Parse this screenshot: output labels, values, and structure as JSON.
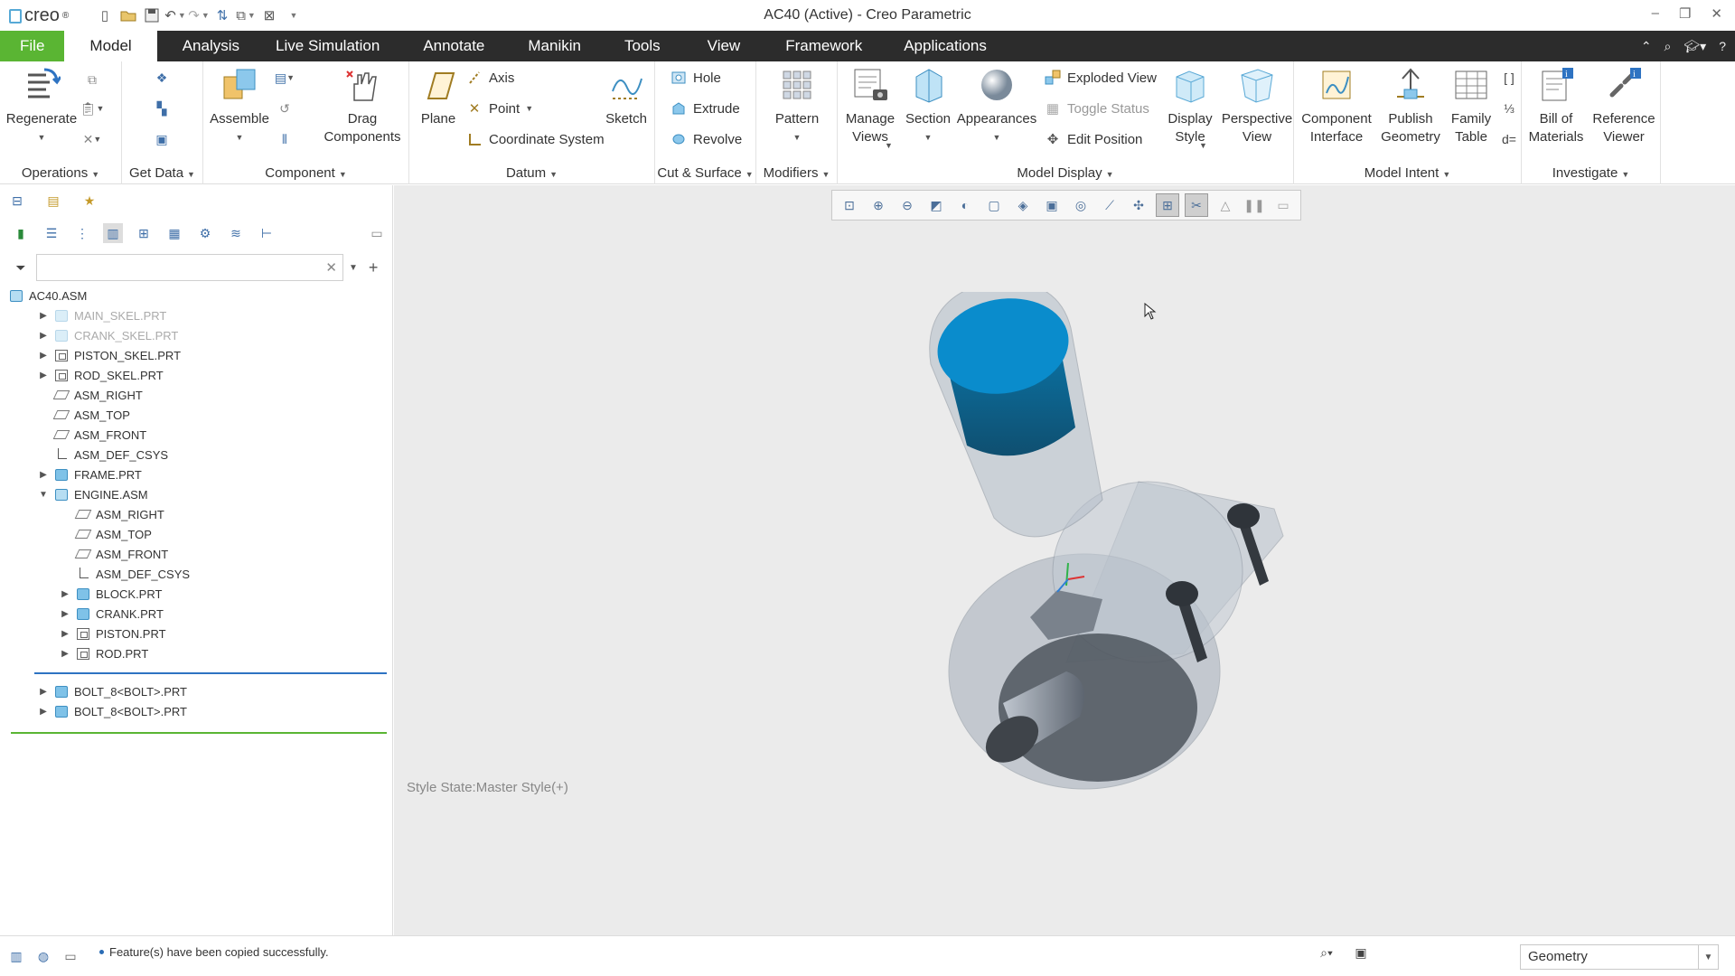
{
  "window": {
    "app_name": "creo",
    "title": "AC40 (Active) - Creo Parametric"
  },
  "menu_tabs": [
    "File",
    "Model",
    "Analysis",
    "Live Simulation",
    "Annotate",
    "Manikin",
    "Tools",
    "View",
    "Framework",
    "Applications"
  ],
  "ribbon": {
    "operations": {
      "label": "Operations",
      "regenerate": "Regenerate"
    },
    "get_data": {
      "label": "Get Data"
    },
    "component": {
      "label": "Component",
      "assemble": "Assemble",
      "drag": "Drag\nComponents"
    },
    "datum": {
      "label": "Datum",
      "plane": "Plane",
      "axis": "Axis",
      "point": "Point",
      "csys": "Coordinate System",
      "sketch": "Sketch"
    },
    "cut_surface": {
      "label": "Cut & Surface",
      "hole": "Hole",
      "extrude": "Extrude",
      "revolve": "Revolve"
    },
    "modifiers": {
      "label": "Modifiers",
      "pattern": "Pattern"
    },
    "model_display": {
      "label": "Model Display",
      "manage_views": "Manage\nViews",
      "section": "Section",
      "appearances": "Appearances",
      "exploded_view": "Exploded View",
      "toggle_status": "Toggle Status",
      "edit_position": "Edit Position",
      "display_style": "Display\nStyle",
      "perspective_view": "Perspective\nView"
    },
    "model_intent": {
      "label": "Model Intent",
      "component_interface": "Component\nInterface",
      "publish_geometry": "Publish\nGeometry",
      "family_table": "Family\nTable"
    },
    "investigate": {
      "label": "Investigate",
      "bom": "Bill of\nMaterials",
      "reference_viewer": "Reference\nViewer"
    }
  },
  "model_tree": {
    "search": {
      "placeholder": "",
      "value": ""
    },
    "items": [
      {
        "name": "AC40.ASM",
        "level": 0,
        "expander": "",
        "icon": "asm",
        "faded": false
      },
      {
        "name": "MAIN_SKEL.PRT",
        "level": 1,
        "expander": "collapsed",
        "icon": "part-faded",
        "faded": true
      },
      {
        "name": "CRANK_SKEL.PRT",
        "level": 1,
        "expander": "collapsed",
        "icon": "skel-faded",
        "faded": true
      },
      {
        "name": "PISTON_SKEL.PRT",
        "level": 1,
        "expander": "collapsed",
        "icon": "skel",
        "faded": false
      },
      {
        "name": "ROD_SKEL.PRT",
        "level": 1,
        "expander": "collapsed",
        "icon": "skel",
        "faded": false
      },
      {
        "name": "ASM_RIGHT",
        "level": 1,
        "expander": "",
        "icon": "plane",
        "faded": false
      },
      {
        "name": "ASM_TOP",
        "level": 1,
        "expander": "",
        "icon": "plane",
        "faded": false
      },
      {
        "name": "ASM_FRONT",
        "level": 1,
        "expander": "",
        "icon": "plane",
        "faded": false
      },
      {
        "name": "ASM_DEF_CSYS",
        "level": 1,
        "expander": "",
        "icon": "csys",
        "faded": false
      },
      {
        "name": "FRAME.PRT",
        "level": 1,
        "expander": "collapsed",
        "icon": "part",
        "faded": false
      },
      {
        "name": "ENGINE.ASM",
        "level": 1,
        "expander": "expanded",
        "icon": "asm",
        "faded": false
      },
      {
        "name": "ASM_RIGHT",
        "level": 2,
        "expander": "",
        "icon": "plane",
        "faded": false
      },
      {
        "name": "ASM_TOP",
        "level": 2,
        "expander": "",
        "icon": "plane",
        "faded": false
      },
      {
        "name": "ASM_FRONT",
        "level": 2,
        "expander": "",
        "icon": "plane",
        "faded": false
      },
      {
        "name": "ASM_DEF_CSYS",
        "level": 2,
        "expander": "",
        "icon": "csys",
        "faded": false
      },
      {
        "name": "BLOCK.PRT",
        "level": 2,
        "expander": "collapsed",
        "icon": "part",
        "faded": false
      },
      {
        "name": "CRANK.PRT",
        "level": 2,
        "expander": "collapsed",
        "icon": "part",
        "faded": false
      },
      {
        "name": "PISTON.PRT",
        "level": 2,
        "expander": "collapsed",
        "icon": "skel",
        "faded": false
      },
      {
        "name": "ROD.PRT",
        "level": 2,
        "expander": "collapsed",
        "icon": "skel",
        "faded": false
      },
      {
        "name": "BOLT_8<BOLT>.PRT",
        "level": 1,
        "expander": "collapsed",
        "icon": "part",
        "faded": false
      },
      {
        "name": "BOLT_8<BOLT>.PRT",
        "level": 1,
        "expander": "collapsed",
        "icon": "part",
        "faded": false
      }
    ]
  },
  "graphics": {
    "style_state": "Style State:Master Style(+)"
  },
  "status": {
    "message": "Feature(s) have been copied successfully.",
    "selection_filter": "Geometry"
  },
  "colors": {
    "file_tab": "#5ab533",
    "menu_bg": "#2c2c2c",
    "graphics_bg": "#ebebeb",
    "accent_blue": "#3d8fc2"
  }
}
